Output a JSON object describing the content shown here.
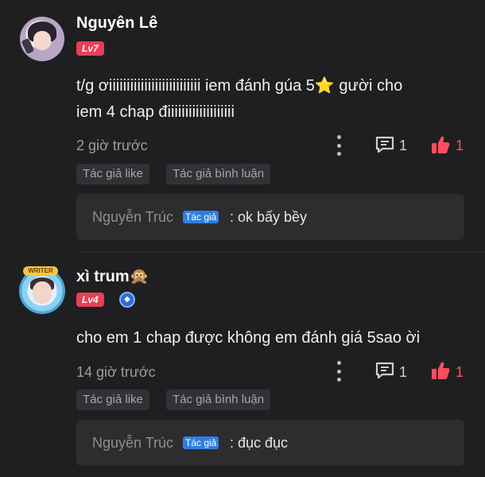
{
  "comments": [
    {
      "user": "Nguyên Lê",
      "level": "Lv7",
      "text_line1": "t/g ơiiiiiiiiiiiiiiiiiiiiiiiiii iem đánh gúa 5⭐ gười cho",
      "text_line2": "iem 4 chap điiiiiiiiiiiiiiiiiii",
      "time": "2 giờ trước",
      "reply_count": "1",
      "like_count": "1",
      "tags": [
        "Tác giả like",
        "Tác giả bình luận"
      ],
      "reply": {
        "author": "Nguyễn Trúc",
        "badge": "Tác giả",
        "text": ": ok bấy bềy"
      }
    },
    {
      "user": "xì trum🙊",
      "level": "Lv4",
      "avatar_frame_label": "WRITER",
      "text_line1": "cho em  1 chap được không em đánh giá 5sao ời",
      "time": "14 giờ trước",
      "reply_count": "1",
      "like_count": "1",
      "tags": [
        "Tác giả like",
        "Tác giả bình luận"
      ],
      "reply": {
        "author": "Nguyễn Trúc",
        "badge": "Tác giả",
        "text": ": đục đục"
      }
    }
  ],
  "colors": {
    "background": "#1f1f21",
    "level_badge": "#e93f56",
    "like": "#ff4d62",
    "author_badge": "#2f7fe0"
  },
  "icons": [
    "more-vertical-icon",
    "comment-icon",
    "thumbs-up-icon",
    "shield-badge-icon"
  ]
}
